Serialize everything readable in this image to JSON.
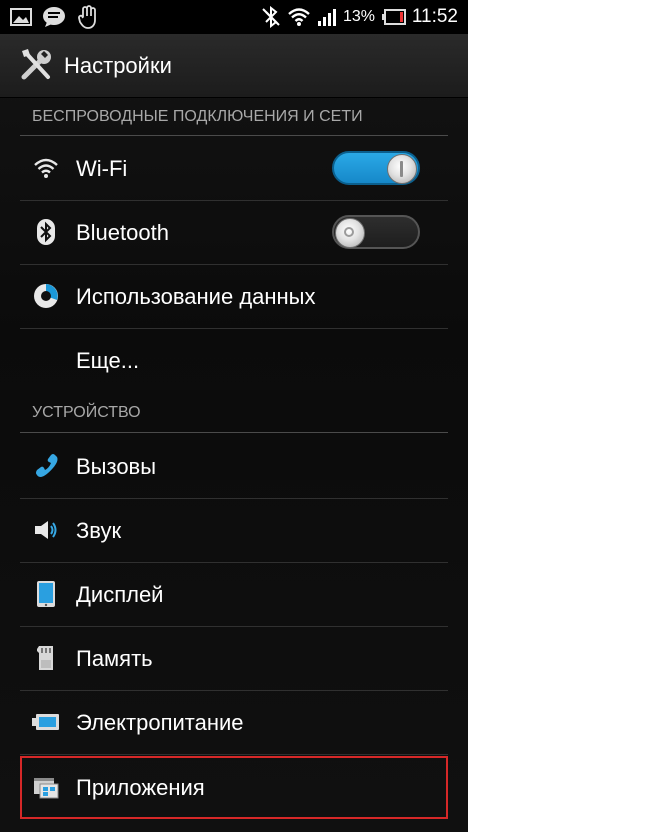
{
  "status_bar": {
    "battery_percent": "13%",
    "time": "11:52",
    "icons": [
      "gallery-icon",
      "chat-icon",
      "gesture-icon",
      "bluetooth-off-icon",
      "wifi-icon",
      "signal-icon",
      "battery-icon"
    ]
  },
  "action_bar": {
    "title": "Настройки",
    "icon": "tools-icon"
  },
  "sections": {
    "wireless": "БЕСПРОВОДНЫЕ ПОДКЛЮЧЕНИЯ И СЕТИ",
    "device": "УСТРОЙСТВО"
  },
  "items": {
    "wifi": {
      "label": "Wi-Fi",
      "icon": "wifi-icon",
      "toggle": "on"
    },
    "bluetooth": {
      "label": "Bluetooth",
      "icon": "bluetooth-icon",
      "toggle": "off"
    },
    "data_usage": {
      "label": "Использование данных",
      "icon": "data-usage-icon"
    },
    "more": {
      "label": "Еще..."
    },
    "calls": {
      "label": "Вызовы",
      "icon": "phone-icon"
    },
    "sound": {
      "label": "Звук",
      "icon": "speaker-icon"
    },
    "display": {
      "label": "Дисплей",
      "icon": "display-icon"
    },
    "memory": {
      "label": "Память",
      "icon": "sd-card-icon"
    },
    "power": {
      "label": "Электропитание",
      "icon": "battery-icon"
    },
    "apps": {
      "label": "Приложения",
      "icon": "apps-icon"
    }
  },
  "colors": {
    "accent": "#1a98d8",
    "highlight": "#d62828",
    "background": "#0d0d0d"
  }
}
